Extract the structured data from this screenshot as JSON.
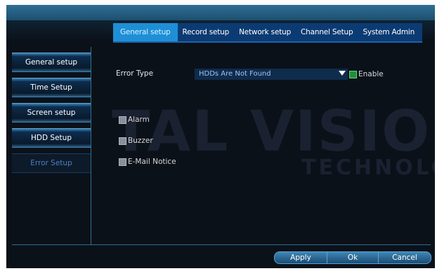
{
  "tabs": [
    {
      "label": "General setup",
      "active": true
    },
    {
      "label": "Record setup",
      "active": false
    },
    {
      "label": "Network setup",
      "active": false
    },
    {
      "label": "Channel Setup",
      "active": false
    },
    {
      "label": "System Admin",
      "active": false
    }
  ],
  "sidebar": {
    "items": [
      {
        "label": "General setup",
        "active": false
      },
      {
        "label": "Time Setup",
        "active": false
      },
      {
        "label": "Screen setup",
        "active": false
      },
      {
        "label": "HDD Setup",
        "active": false
      },
      {
        "label": "Error Setup",
        "active": true
      }
    ]
  },
  "form": {
    "error_type_label": "Error Type",
    "error_type_value": "HDDs Are Not Found",
    "enable_label": "Enable",
    "enable_checked": true,
    "alarm_label": "Alarm",
    "alarm_checked": false,
    "buzzer_label": "Buzzer",
    "buzzer_checked": false,
    "email_label": "E-Mail Notice",
    "email_checked": false
  },
  "buttons": {
    "apply": "Apply",
    "ok": "Ok",
    "cancel": "Cancel"
  },
  "watermark": {
    "line1": "TAL VISIO",
    "line2": "TECHNOLO"
  },
  "colors": {
    "background": "#0b1119",
    "tab_active": "#1e8fd6",
    "tab_bar": "#0c3b73",
    "sidebar_active_text": "#4d7fc2",
    "enable_checkbox": "#1f8f3c"
  }
}
